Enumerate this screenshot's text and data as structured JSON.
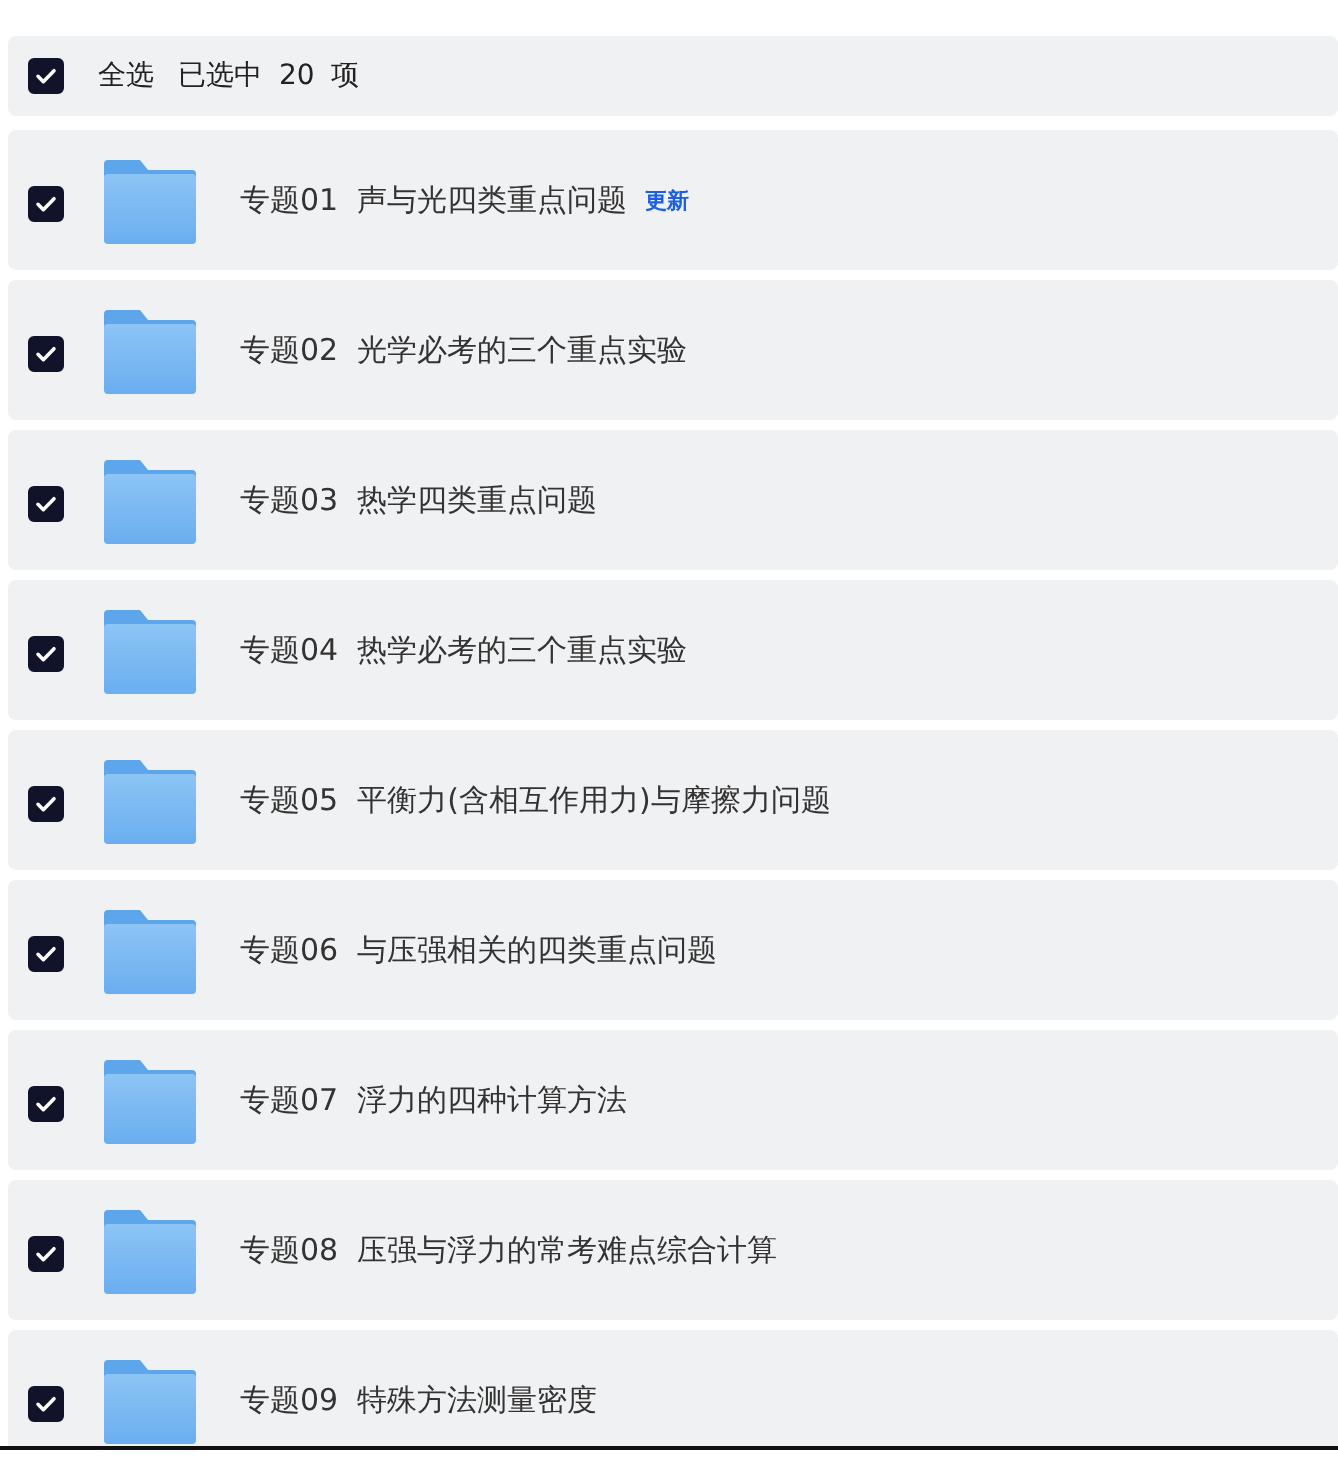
{
  "select_bar": {
    "checked": true,
    "label": "全选",
    "selected_prefix": "已选中",
    "selected_count": "20",
    "selected_suffix": "项"
  },
  "folders": [
    {
      "checked": true,
      "name": "专题01  声与光四类重点问题",
      "badge": "更新"
    },
    {
      "checked": true,
      "name": "专题02  光学必考的三个重点实验"
    },
    {
      "checked": true,
      "name": "专题03  热学四类重点问题"
    },
    {
      "checked": true,
      "name": "专题04  热学必考的三个重点实验"
    },
    {
      "checked": true,
      "name": "专题05  平衡力(含相互作用力)与摩擦力问题"
    },
    {
      "checked": true,
      "name": "专题06  与压强相关的四类重点问题"
    },
    {
      "checked": true,
      "name": "专题07  浮力的四种计算方法"
    },
    {
      "checked": true,
      "name": "专题08  压强与浮力的常考难点综合计算"
    },
    {
      "checked": true,
      "name": "专题09  特殊方法测量密度"
    }
  ]
}
